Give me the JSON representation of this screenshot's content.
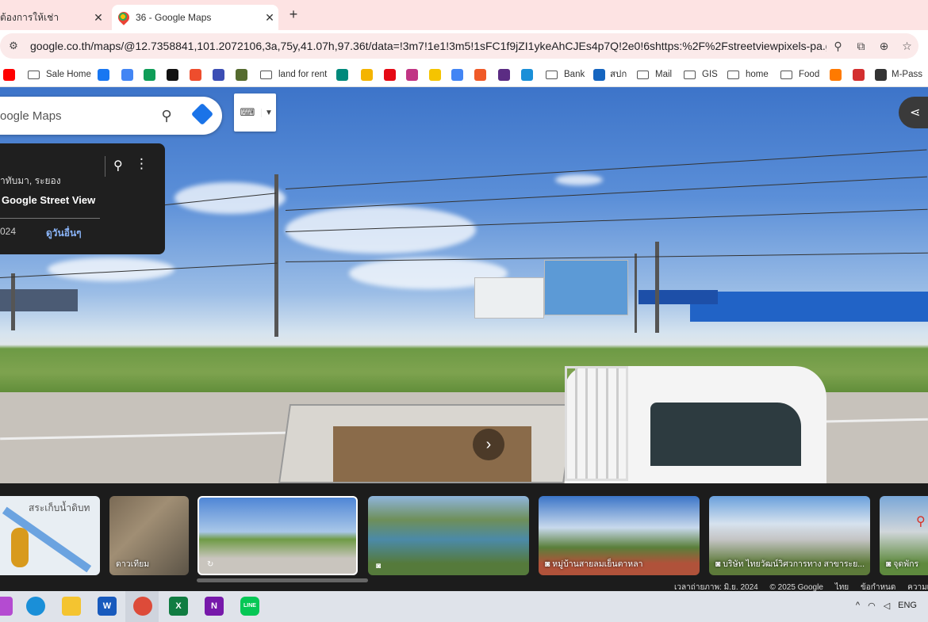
{
  "browser": {
    "tabs": [
      {
        "label": "ต้องการให้เช่า",
        "close": "✕",
        "active": false
      },
      {
        "label": "36 - Google Maps",
        "close": "✕",
        "active": true
      }
    ],
    "new_tab": "+",
    "url": "google.co.th/maps/@12.7358841,101.2072106,3a,75y,41.07h,97.36t/data=!3m7!1e1!3m5!1sFC1f9jZI1ykeAhCJEs4p7Q!2e0!6shttps:%2F%2Fstreetviewpixels-pa.googleapis.com%2...",
    "address_actions": [
      "location-icon",
      "install-icon",
      "zoom-icon",
      "bookmark-star-icon"
    ]
  },
  "bookmarks": [
    {
      "label": "",
      "icon": "youtube-icon",
      "color": "#ff0000"
    },
    {
      "label": "Sale Home",
      "icon": "folder-icon"
    },
    {
      "label": "",
      "icon": "facebook-icon",
      "color": "#1877f2"
    },
    {
      "label": "",
      "icon": "google-icon",
      "color": "#4285f4"
    },
    {
      "label": "",
      "icon": "drive-icon",
      "color": "#0f9d58"
    },
    {
      "label": "",
      "icon": "s-icon",
      "color": "#111111"
    },
    {
      "label": "",
      "icon": "shop-icon",
      "color": "#ee4d2d"
    },
    {
      "label": "",
      "icon": "app-icon",
      "color": "#3c4eb4"
    },
    {
      "label": "",
      "icon": "web-icon",
      "color": "#556b2f"
    },
    {
      "label": "land for rent",
      "icon": "folder-icon"
    },
    {
      "label": "",
      "icon": "meet-icon",
      "color": "#00897b"
    },
    {
      "label": "",
      "icon": "mark-icon",
      "color": "#f4b400"
    },
    {
      "label": "",
      "icon": "netflix-icon",
      "color": "#e50914"
    },
    {
      "label": "",
      "icon": "instagram-icon",
      "color": "#c13584"
    },
    {
      "label": "",
      "icon": "bubble-icon",
      "color": "#f5c400"
    },
    {
      "label": "",
      "icon": "translate-icon",
      "color": "#4285f4"
    },
    {
      "label": "",
      "icon": "bag-icon",
      "color": "#f05a28"
    },
    {
      "label": "",
      "icon": "photo-icon",
      "color": "#5b2c83"
    },
    {
      "label": "",
      "icon": "edge-icon",
      "color": "#1a8fd8"
    },
    {
      "label": "Bank",
      "icon": "folder-icon"
    },
    {
      "label": "สปก",
      "icon": "seal-icon",
      "color": "#1565c0"
    },
    {
      "label": "Mail",
      "icon": "folder-icon"
    },
    {
      "label": "GIS",
      "icon": "folder-icon"
    },
    {
      "label": "home",
      "icon": "folder-icon"
    },
    {
      "label": "Food",
      "icon": "folder-icon"
    },
    {
      "label": "",
      "icon": "orange-icon",
      "color": "#ff7a00"
    },
    {
      "label": "",
      "icon": "red-logo-icon",
      "color": "#d32f2f"
    },
    {
      "label": "M-Pass",
      "icon": "globe-icon",
      "color": "#333333"
    }
  ],
  "map": {
    "search_placeholder": "oogle Maps",
    "keyboard_label": "⌨",
    "info_card": {
      "address": "าทับมา, ระยอง",
      "source": "Google Street View",
      "year": "024",
      "see_more": "ดูวันอื่นๆ"
    }
  },
  "filmstrip": {
    "thumbs": [
      {
        "caption": "สระเก็บน้ำดิบท",
        "kind": "map"
      },
      {
        "caption": "ดาวเทียม",
        "kind": "satellite"
      },
      {
        "caption": "",
        "kind": "street-view"
      },
      {
        "caption": "",
        "kind": "photo"
      },
      {
        "caption": "หมู่บ้านสายลมเย็นตาหลา",
        "kind": "photo"
      },
      {
        "caption": "บริษัท ไทยวัฒน์วิศวการทาง สาขาระย...",
        "kind": "photo"
      },
      {
        "caption": "จุดพักร",
        "kind": "photo"
      }
    ],
    "footer": [
      "เวลาถ่ายภาพ: มิ.ย. 2024",
      "© 2025 Google",
      "ไทย",
      "ข้อกำหนด",
      "ความเป็น"
    ]
  },
  "taskbar": {
    "apps": [
      {
        "name": "copilot-icon",
        "label": "",
        "color": "#b44bd1"
      },
      {
        "name": "edge-icon",
        "label": "",
        "color": "#1a8fd8"
      },
      {
        "name": "file-explorer-icon",
        "label": "",
        "color": "#f4c430"
      },
      {
        "name": "word-icon",
        "label": "W",
        "color": "#185abd"
      },
      {
        "name": "chrome-icon",
        "label": "",
        "color": "#dd4b39"
      },
      {
        "name": "excel-icon",
        "label": "X",
        "color": "#107c41"
      },
      {
        "name": "onenote-icon",
        "label": "N",
        "color": "#7719aa"
      },
      {
        "name": "line-icon",
        "label": "LINE",
        "color": "#06c755"
      }
    ],
    "tray": [
      "^",
      "ENG"
    ]
  }
}
